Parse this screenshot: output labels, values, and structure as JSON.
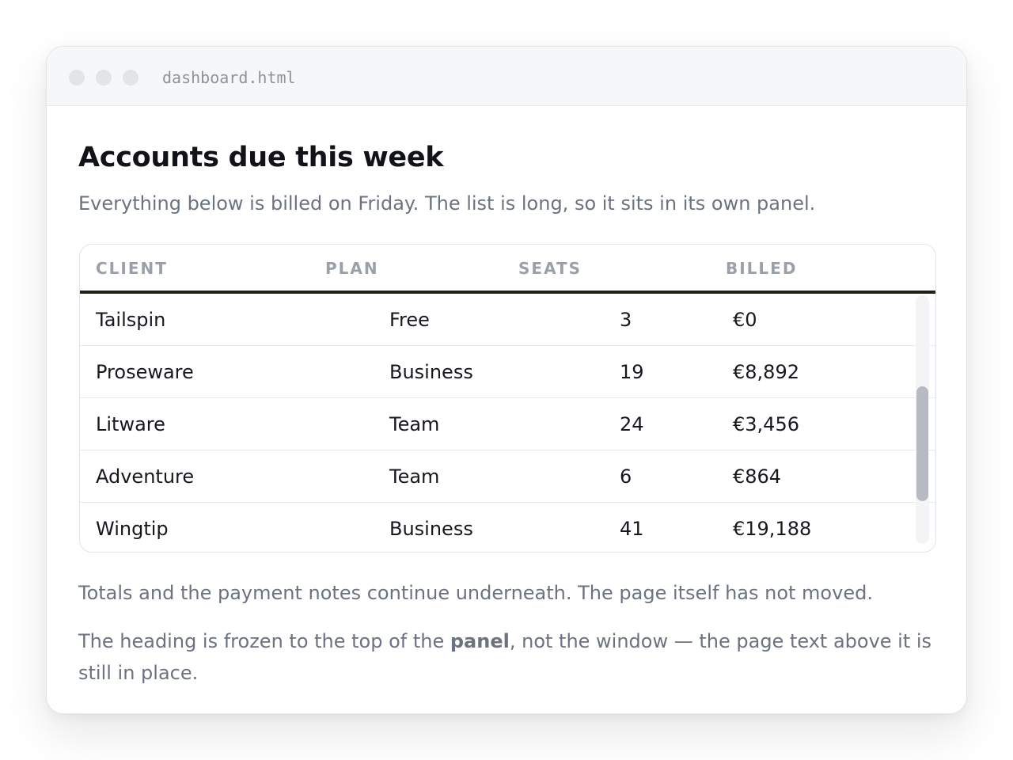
{
  "window": {
    "title": "dashboard.html"
  },
  "page": {
    "heading": "Accounts due this week",
    "intro": "Everything below is billed on Friday. The list is long, so it sits in its own panel."
  },
  "table": {
    "columns": [
      "CLIENT",
      "PLAN",
      "SEATS",
      "BILLED"
    ],
    "rows": [
      {
        "client": "Tailspin",
        "plan": "Free",
        "seats": "3",
        "billed": "€0"
      },
      {
        "client": "Proseware",
        "plan": "Business",
        "seats": "19",
        "billed": "€8,892"
      },
      {
        "client": "Litware",
        "plan": "Team",
        "seats": "24",
        "billed": "€3,456"
      },
      {
        "client": "Adventure",
        "plan": "Team",
        "seats": "6",
        "billed": "€864"
      },
      {
        "client": "Wingtip",
        "plan": "Business",
        "seats": "41",
        "billed": "€19,188"
      }
    ]
  },
  "notes": {
    "totals": "Totals and the payment notes continue underneath. The page itself has not moved.",
    "frozen_before": "The heading is frozen to the top of the ",
    "frozen_bold": "panel",
    "frozen_after": ", not the window — the page text above it is still in place."
  },
  "colors": {
    "header_rule": "#1f2014",
    "scroll_thumb": "#b7bac2",
    "muted_text": "#6b7280"
  }
}
